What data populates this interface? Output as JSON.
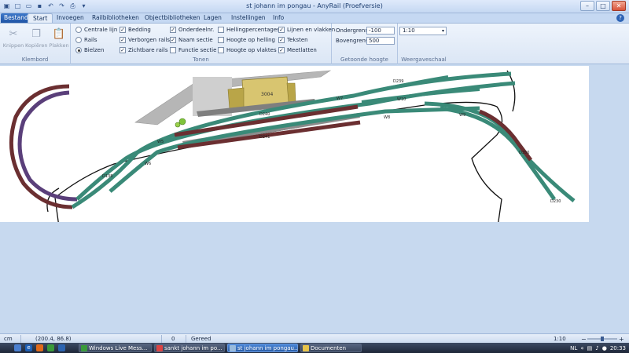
{
  "window": {
    "title": "st johann im pongau - AnyRail (Proefversie)"
  },
  "tabs": [
    {
      "label": "Bestand"
    },
    {
      "label": "Start"
    },
    {
      "label": "Invoegen"
    },
    {
      "label": "Railbibliotheken"
    },
    {
      "label": "Objectbibliotheken"
    },
    {
      "label": "Lagen"
    },
    {
      "label": "Instellingen"
    },
    {
      "label": "Info"
    }
  ],
  "ribbon": {
    "clipboard": {
      "label": "Klembord",
      "cut": "Knippen",
      "copy": "Kopiëren",
      "paste": "Plakken"
    },
    "show": {
      "label": "Tonen",
      "centerline": "Centrale lijn",
      "rails": "Rails",
      "sleepers": "Bielzen",
      "bedding": "Bedding",
      "hidden_rails": "Verborgen rails",
      "visible_rails": "Zichtbare rails",
      "part_numbers": "Onderdeelnr.",
      "section_name": "Naam sectie",
      "function_section": "Functie sectie",
      "slope_pct": "Hellingpercentages",
      "slope_height": "Hoogte op helling",
      "plane_height": "Hoogte op vlaktes",
      "lines_planes": "Lijnen en vlakken",
      "texts": "Teksten",
      "measure": "Meetlatten"
    },
    "height": {
      "label": "Getoonde hoogte",
      "lower_label": "Ondergrens",
      "lower_value": "-100",
      "upper_label": "Bovengrens",
      "upper_value": "500"
    },
    "scale": {
      "label": "Weergaveschaal",
      "value": "1:10"
    }
  },
  "layout_labels": {
    "building": "3004",
    "w5": "W5",
    "w6": "W6",
    "w7": "W7",
    "w8": "W8",
    "w9": "W9",
    "w10": "W10",
    "d239": "D239",
    "d138": "D138",
    "d240": "D240",
    "d241": "D241",
    "d230": "D230",
    "d350": "D350"
  },
  "statusbar": {
    "unit": "cm",
    "coords": "(200.4, 86.8)",
    "count": "0",
    "status": "Gereed",
    "zoom": "1:10"
  },
  "taskbar": {
    "tasks": [
      {
        "label": "Windows Live Mess..."
      },
      {
        "label": "sankt johann im po..."
      },
      {
        "label": "st johann im pongau..."
      },
      {
        "label": "Documenten"
      }
    ],
    "lang": "NL",
    "clock": "20:33"
  },
  "colors": {
    "track_green": "#3a8a78",
    "track_red": "#6b2f31",
    "track_purple": "#5a3f7a",
    "platform_grey": "#9a9a9a",
    "building_yellow": "#c6b25a"
  }
}
